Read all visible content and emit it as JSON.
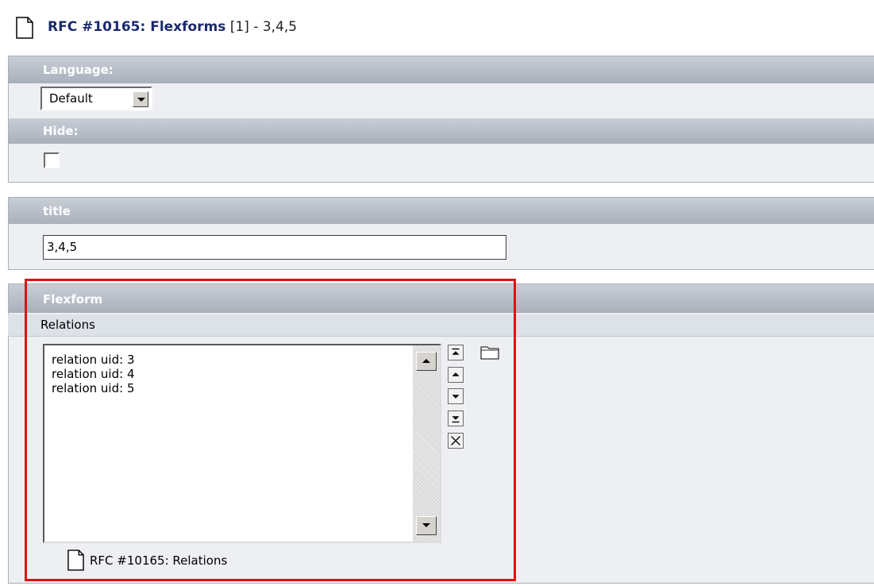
{
  "header": {
    "record_title": "RFC #10165: Flexforms",
    "record_suffix": "[1] - 3,4,5",
    "icon": "document-icon"
  },
  "language": {
    "label": "Language:",
    "selected": "Default",
    "icon": "dropdown-arrow-icon"
  },
  "hide": {
    "label": "Hide:",
    "checked": false
  },
  "title_field": {
    "label": "title",
    "value": "3,4,5"
  },
  "flexform": {
    "label": "Flexform",
    "section_label": "Relations",
    "relations": [
      "relation uid: 3",
      "relation uid: 4",
      "relation uid: 5"
    ],
    "controls": [
      "move-to-top-icon",
      "move-up-icon",
      "move-down-icon",
      "move-to-bottom-icon",
      "remove-icon"
    ],
    "browse_icon": "folder-icon",
    "related_record": "RFC #10165: Relations",
    "highlight_color": "#e01010"
  },
  "colors": {
    "bar_top": "#c9ced6",
    "bar_bottom": "#a9b0bc",
    "panel_bg": "#eeeff2",
    "title_link": "#1a2a6c"
  }
}
